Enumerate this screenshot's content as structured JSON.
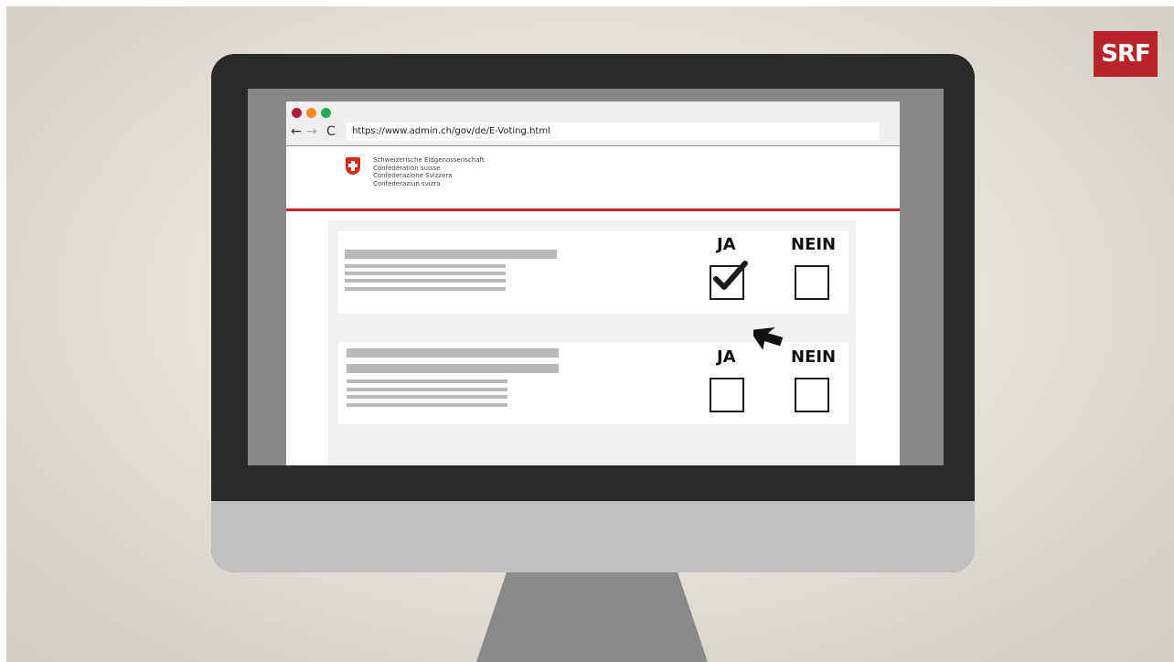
{
  "logo": {
    "text": "SRF",
    "color": "#b8242a"
  },
  "browser": {
    "window_controls": [
      "close",
      "minimize",
      "maximize"
    ],
    "nav": {
      "back": "←",
      "forward": "→",
      "reload": "C"
    },
    "url": "https://www.admin.ch/gov/de/E-Voting.html"
  },
  "government": {
    "lines": [
      "Schweizerische Eidgenossenschaft",
      "Confédération suisse",
      "Confederazione Svizzera",
      "Confederaziun svizra"
    ],
    "accent_color": "#c2272d"
  },
  "ballot": {
    "questions": [
      {
        "yes_label": "JA",
        "no_label": "NEIN",
        "yes_checked": true,
        "no_checked": false
      },
      {
        "yes_label": "JA",
        "no_label": "NEIN",
        "yes_checked": false,
        "no_checked": false
      }
    ]
  }
}
